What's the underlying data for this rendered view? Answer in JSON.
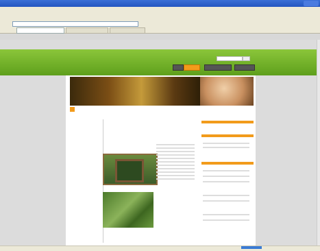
{
  "browser": {
    "title": "",
    "menu": [
      "",
      "",
      "",
      "",
      "",
      ""
    ],
    "address": "",
    "tabs": [
      ""
    ]
  },
  "site": {
    "name": "",
    "nav": [
      "",
      "",
      "",
      ""
    ],
    "page_title": "",
    "left_nav": [
      "",
      "",
      "",
      "",
      "",
      "",
      "",
      "",
      "",
      ""
    ],
    "content_heading": "",
    "article_title": "",
    "photo_caption": ""
  },
  "colors": {
    "header_green": "#6fb02a",
    "accent_orange": "#f29b1b"
  }
}
